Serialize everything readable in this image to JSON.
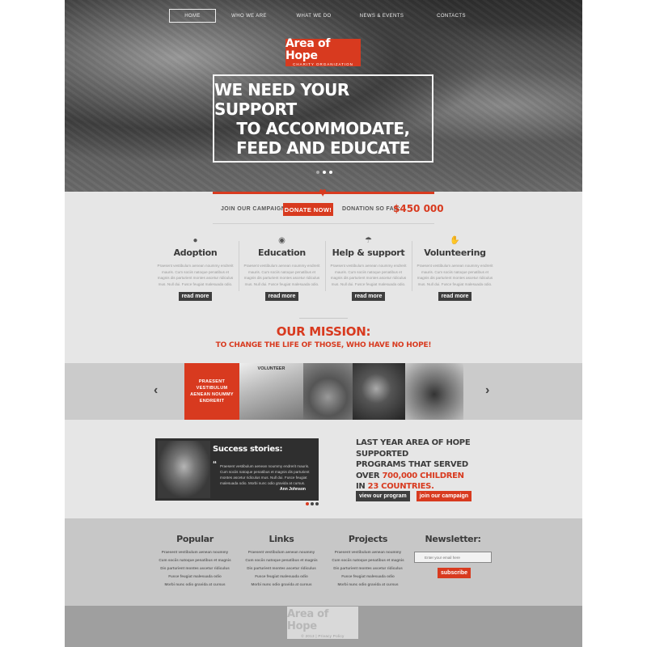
{
  "nav": {
    "items": [
      "HOME",
      "WHO WE ARE",
      "WHAT WE DO",
      "NEWS & EVENTS",
      "CONTACTS"
    ]
  },
  "logo": {
    "name": "Area of Hope",
    "tagline": "CHARITY ORGANIZATION"
  },
  "hero": {
    "headline": [
      "WE NEED YOUR SUPPORT",
      "TO ACCOMMODATE,",
      "FEED AND EDUCATE"
    ],
    "slide_active": 2,
    "slide_count": 3
  },
  "campaign": {
    "join_label": "JOIN OUR CAMPAIGN!",
    "donate_button": "DONATE NOW!",
    "donation_label": "DONATION SO FAR:",
    "donation_amount": "$450 000"
  },
  "features": [
    {
      "icon": "balloon-icon",
      "title": "Adoption",
      "text": "Praesent vestibulum aenean noummy endrerit mauris. Cum sociis natoque penatibus et magnis dis parturient montes ascetur ridiculus mus. Null dui. Fusce feugiat malesuada odio.",
      "more": "read more"
    },
    {
      "icon": "globe-icon",
      "title": "Education",
      "text": "Praesent vestibulum aenean noummy endrerit mauris. Cum sociis natoque penatibus et magnis dis parturient montes ascetur ridiculus mus. Null dui. Fusce feugiat malesuada odio.",
      "more": "read more"
    },
    {
      "icon": "umbrella-icon",
      "title": "Help & support",
      "text": "Praesent vestibulum aenean noummy endrerit mauris. Cum sociis natoque penatibus et magnis dis parturient montes ascetur ridiculus mus. Null dui. Fusce feugiat malesuada odio.",
      "more": "read more"
    },
    {
      "icon": "hand-icon",
      "title": "Volunteering",
      "text": "Praesent vestibulum aenean noummy endrerit mauris. Cum sociis natoque penatibus et magnis dis parturient montes ascetur ridiculus mus. Null dui. Fusce feugiat malesuada odio.",
      "more": "read more"
    }
  ],
  "mission": {
    "title": "OUR MISSION:",
    "subtitle": "TO CHANGE THE LIFE OF THOSE, WHO HAVE NO HOPE!"
  },
  "gallery": {
    "caption": "PRAESENT VESTIBULUM AENEAN NOUMMY ENDRERIT",
    "photo_label": "VOLUNTEER",
    "prev": "‹",
    "next": "›"
  },
  "stories": {
    "title": "Success stories:",
    "quote_mark": "“",
    "text": "Praesent vestibulum aenean noummy endrerit mauris. Cum sociis natoque penatibus et magnis dis parturient montes ascetur ridiculus mus. Null dui. Fusce feugiat malesuada odio. Morbi nunc odio gravida at cursus.",
    "author": "Ann Johnson",
    "dot_active": 1
  },
  "stats": {
    "line1": "LAST YEAR AREA OF HOPE SUPPORTED",
    "line2": "PROGRAMS THAT SERVED",
    "line3_pre": "OVER ",
    "line3_hl": "700,000 CHILDREN",
    "line4_pre": "IN ",
    "line4_hl": "23 COUNTRIES.",
    "btn_program": "view our program",
    "btn_campaign": "join our campaign"
  },
  "footer": {
    "columns": [
      {
        "title": "Popular",
        "items": [
          "Praesent vestibulum aenean noummy",
          "Cum sociis natoque penatibus et magnis",
          "Dis parturient montes ascetur ridiculus",
          "Fusce feugiat malesuada odio",
          "Morbi nunc odio gravida at cursus"
        ]
      },
      {
        "title": "Links",
        "items": [
          "Praesent vestibulum aenean noummy",
          "Cum sociis natoque penatibus et magnis",
          "Dis parturient montes ascetur ridiculus",
          "Fusce feugiat malesuada odio",
          "Morbi nunc odio gravida at cursus"
        ]
      },
      {
        "title": "Projects",
        "items": [
          "Praesent vestibulum aenean noummy",
          "Cum sociis natoque penatibus et magnis",
          "Dis parturient montes ascetur ridiculus",
          "Fusce feugiat malesuada odio",
          "Morbi nunc odio gravida at cursus"
        ]
      }
    ],
    "newsletter_title": "Newsletter:",
    "newsletter_placeholder": "Enter your email here",
    "subscribe": "subscribe",
    "logo_name": "Area of Hope",
    "copyright": "© 2013 | Privacy Policy"
  },
  "colors": {
    "accent": "#d83a1f",
    "dark": "#3e3e3e",
    "background": "#e6e6e6"
  }
}
